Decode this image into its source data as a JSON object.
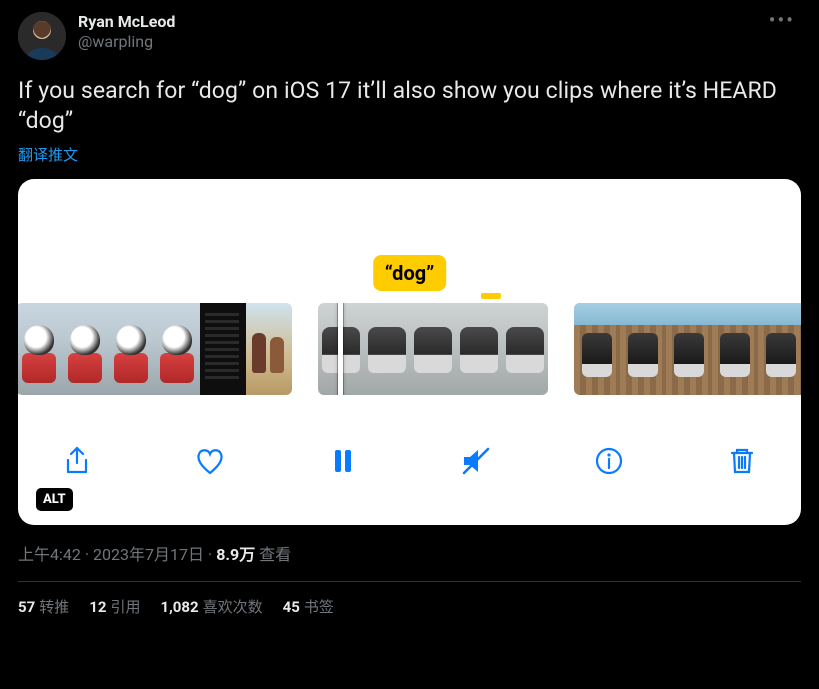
{
  "user": {
    "display_name": "Ryan McLeod",
    "handle": "@warpling"
  },
  "tweet": {
    "text": "If you search for “dog” on iOS 17 it’ll also show you clips where it’s HEARD “dog”",
    "translate_label": "翻译推文"
  },
  "media": {
    "caption_pill": "“dog”",
    "alt_badge": "ALT",
    "toolbar": {
      "share": "share-icon",
      "heart": "heart-icon",
      "pause": "pause-icon",
      "mute": "mute-icon",
      "info": "info-icon",
      "trash": "trash-icon"
    }
  },
  "meta": {
    "time": "上午4:42",
    "date": "2023年7月17日",
    "views_number": "8.9万",
    "views_label": "查看"
  },
  "stats": {
    "retweets_count": "57",
    "retweets_label": "转推",
    "quotes_count": "12",
    "quotes_label": "引用",
    "likes_count": "1,082",
    "likes_label": "喜欢次数",
    "bookmarks_count": "45",
    "bookmarks_label": "书签"
  }
}
